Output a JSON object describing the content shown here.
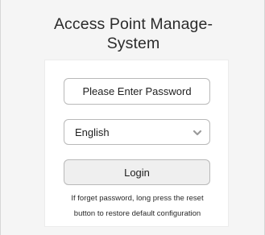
{
  "title": {
    "line1": "Access Point Manage-",
    "line2": "System"
  },
  "password": {
    "placeholder": "Please Enter Password",
    "value": ""
  },
  "language": {
    "selected": "English",
    "icon": "chevron-down-icon"
  },
  "login": {
    "label": "Login"
  },
  "hint": {
    "line1": "If forget password, long press the reset",
    "line2": "button to restore default configuration"
  }
}
